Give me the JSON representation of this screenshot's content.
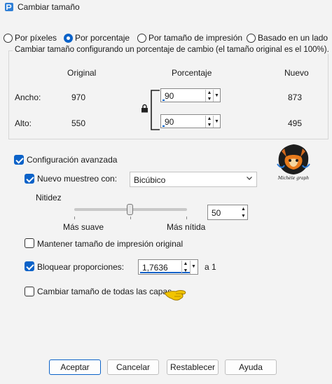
{
  "window": {
    "title": "Cambiar tamaño"
  },
  "mode_options": [
    {
      "label": "Por píxeles",
      "selected": false
    },
    {
      "label": "Por porcentaje",
      "selected": true
    },
    {
      "label": "Por tamaño de impresión",
      "selected": false
    },
    {
      "label": "Basado en un lado",
      "selected": false
    }
  ],
  "percent_group": {
    "legend": "Cambiar tamaño configurando un porcentaje de cambio (el tamaño original es el 100%).",
    "headers": {
      "original": "Original",
      "percentage": "Porcentaje",
      "new": "Nuevo"
    },
    "width": {
      "label": "Ancho:",
      "original": "970",
      "percentage": "90",
      "new": "873"
    },
    "height": {
      "label": "Alto:",
      "original": "550",
      "percentage": "90",
      "new": "495"
    }
  },
  "advanced": {
    "label": "Configuración avanzada",
    "checked": true,
    "resample": {
      "label": "Nuevo muestreo con:",
      "checked": true,
      "method": "Bicúbico"
    },
    "sharpness": {
      "label": "Nitidez",
      "min_label": "Más suave",
      "max_label": "Más nítida",
      "value": "50",
      "level": 0.5
    },
    "keep_print_size": {
      "label": "Mantener tamaño de impresión original",
      "checked": false
    },
    "lock_ratio": {
      "label": "Bloquear proporciones:",
      "checked": true,
      "value": "1,7636",
      "suffix": "a 1"
    },
    "resize_all_layers": {
      "label": "Cambiar tamaño de todas las capas",
      "checked": false
    }
  },
  "watermark": {
    "text": "Michèle graph"
  },
  "buttons": {
    "ok": "Aceptar",
    "cancel": "Cancelar",
    "reset": "Restablecer",
    "help": "Ayuda"
  },
  "colors": {
    "accent": "#0b62c8",
    "background": "#f3f3f3"
  }
}
